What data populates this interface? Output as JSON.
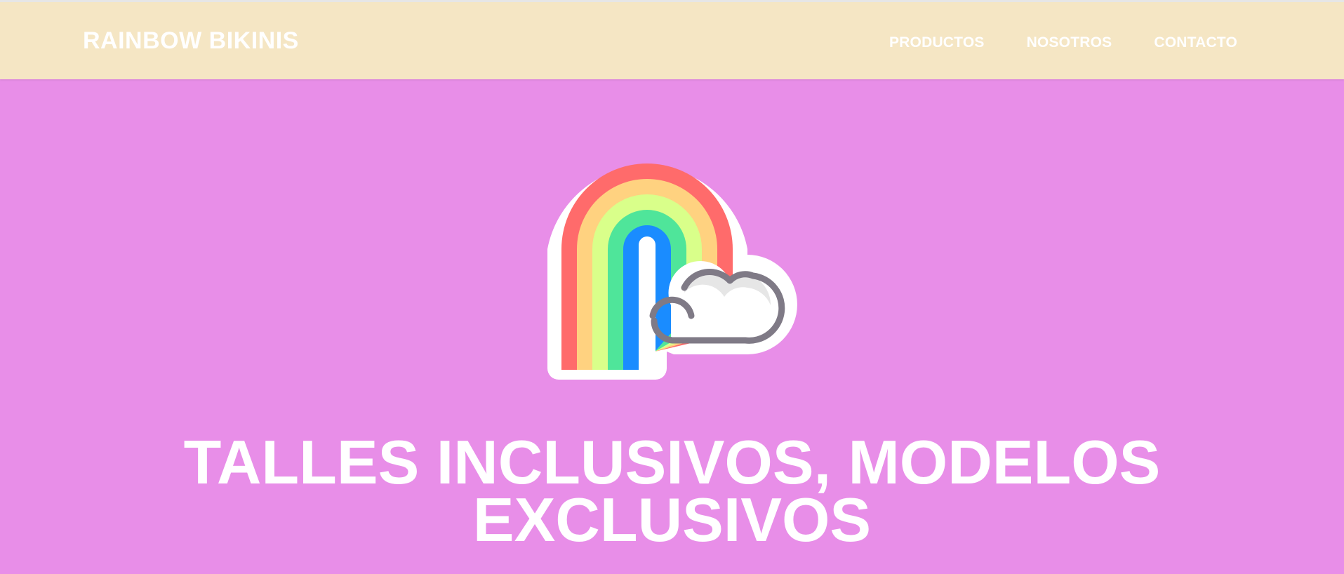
{
  "header": {
    "brand": "RAINBOW BIKINIS",
    "nav": [
      {
        "label": "PRODUCTOS"
      },
      {
        "label": "NOSOTROS"
      },
      {
        "label": "CONTACTO"
      }
    ]
  },
  "hero": {
    "icon": "rainbow-cloud-icon",
    "headline": "TALLES INCLUSIVOS, MODELOS EXCLUSIVOS"
  },
  "colors": {
    "background": "#e88ee8",
    "navbar": "#f5e6c4",
    "text": "#ffffff",
    "rainbow": [
      "#ff6b6b",
      "#ffd280",
      "#d9ff8a",
      "#4fe59a",
      "#1a8cff"
    ],
    "cloud_outline": "#7f7a86"
  }
}
